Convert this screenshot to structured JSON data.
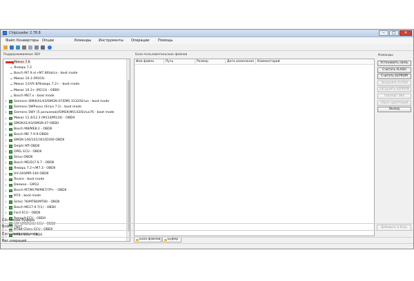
{
  "window": {
    "title": "ChipLoader 2.78.8"
  },
  "menu": [
    "Файл",
    "Конверторы",
    "Опции",
    "Команды",
    "Инструменты",
    "Операции",
    "Помощь"
  ],
  "toolbar_icons": [
    "folder-open-icon",
    "save-icon",
    "undo-icon",
    "cut-icon",
    "copy-icon",
    "paste-icon",
    "print-icon",
    "help-icon"
  ],
  "tree": {
    "label": "Поддерживаемые ЭБУ",
    "items": [
      {
        "label": "Микас 7.6",
        "kind": "selected"
      },
      {
        "label": "Январь 7.2",
        "kind": "leaf"
      },
      {
        "label": "Bosch M7.9.х(+M7.8/Italica - boot mode",
        "kind": "leaf"
      },
      {
        "label": "Микас 10.3 (M103)",
        "kind": "leaf"
      },
      {
        "label": "Микас 11/VS 8/Январь 7.2+ - boot mode",
        "kind": "leaf"
      },
      {
        "label": "Микас 10.3+ (M113) - OBDII",
        "kind": "leaf"
      },
      {
        "label": "Bosch ME7.x - boot mode",
        "kind": "leaf"
      },
      {
        "label": "Siemens SIM(K41/43/SIM2K-47/EMS 3132/Sirius - boot mode",
        "kind": "group"
      },
      {
        "label": "Siemens 5WPxxxx (Sirius 7.1) - boot mode",
        "kind": "group"
      },
      {
        "label": "Siemens 5WY (5 разъемов)/SIM2K(M)143/Sirius76 - boot mode",
        "kind": "group"
      },
      {
        "label": "Микас 11.4/12.3 (M114/M124) - OBDII",
        "kind": "group"
      },
      {
        "label": "SIM2K41/43/SIM2K-47-OBDII",
        "kind": "group"
      },
      {
        "label": "Bosch M8/ME8.2 - OBDII",
        "kind": "group"
      },
      {
        "label": "Bosch ME 7.9.9-OBDII",
        "kind": "group"
      },
      {
        "label": "SIM2K-140/141/341/D160-OBDII",
        "kind": "group"
      },
      {
        "label": "Delphi MT-OBDII",
        "kind": "group"
      },
      {
        "label": "OPEL ECU - OBDII",
        "kind": "group"
      },
      {
        "label": "Sirius-OBDII",
        "kind": "group"
      },
      {
        "label": "Bosch ME(D)7.9.7 - OBDII",
        "kind": "group"
      },
      {
        "label": "Январь 7.2+/M7.3 - OBDII",
        "kind": "group"
      },
      {
        "label": "HV-240/MR-140-OBDII",
        "kind": "group"
      },
      {
        "label": "Tecore - boot mode",
        "kind": "group"
      },
      {
        "label": "Dаewoo - GM12",
        "kind": "group"
      },
      {
        "label": "Bosch M7/M(7M/ME7/7P+ - OBDII",
        "kind": "group"
      },
      {
        "label": "M74 - boot mode",
        "kind": "group"
      },
      {
        "label": "Sirtec 76/MT80/MT80 - OBDII",
        "kind": "group"
      },
      {
        "label": "Bosch ME17.9.7(1) - OBDII",
        "kind": "group"
      },
      {
        "label": "Ford ECU - OBDII",
        "kind": "group"
      },
      {
        "label": "Renault ECU - OBDII",
        "kind": "group"
      },
      {
        "label": "GM SIM2K243 ECU - OBDII",
        "kind": "group"
      },
      {
        "label": "MT88 Chery ECU - OBDII",
        "kind": "group"
      },
      {
        "label": "MT86 ECU - OBDII",
        "kind": "group"
      }
    ]
  },
  "files": {
    "label": "База пользовательских файлов",
    "columns": [
      "Имя файла",
      "Путь",
      "Размер",
      "Дата изменения",
      "Комментарий"
    ],
    "tabs": [
      "База файлов",
      "Буфер"
    ]
  },
  "commands": {
    "label": "Команды",
    "buttons": [
      {
        "label": "Установить связь",
        "enabled": true
      },
      {
        "label": "Считать FLASH",
        "enabled": true
      },
      {
        "label": "Считать EEPROM",
        "enabled": true
      },
      {
        "label": "Загрузить FLASH",
        "enabled": false
      },
      {
        "label": "Загрузить EEPROM",
        "enabled": false
      },
      {
        "label": "Паспорт ЭБУ",
        "enabled": false
      },
      {
        "label": "Сброс адаптаций",
        "enabled": false
      },
      {
        "label": "Выход",
        "enabled": true
      }
    ]
  },
  "status": {
    "buffer_state": "Состояние буфера",
    "buffer_empty": "Буфер пуст",
    "process_state": "Состояние процесса",
    "no_operations": "Нет операций",
    "add_to_db": "Добавить в базу"
  }
}
